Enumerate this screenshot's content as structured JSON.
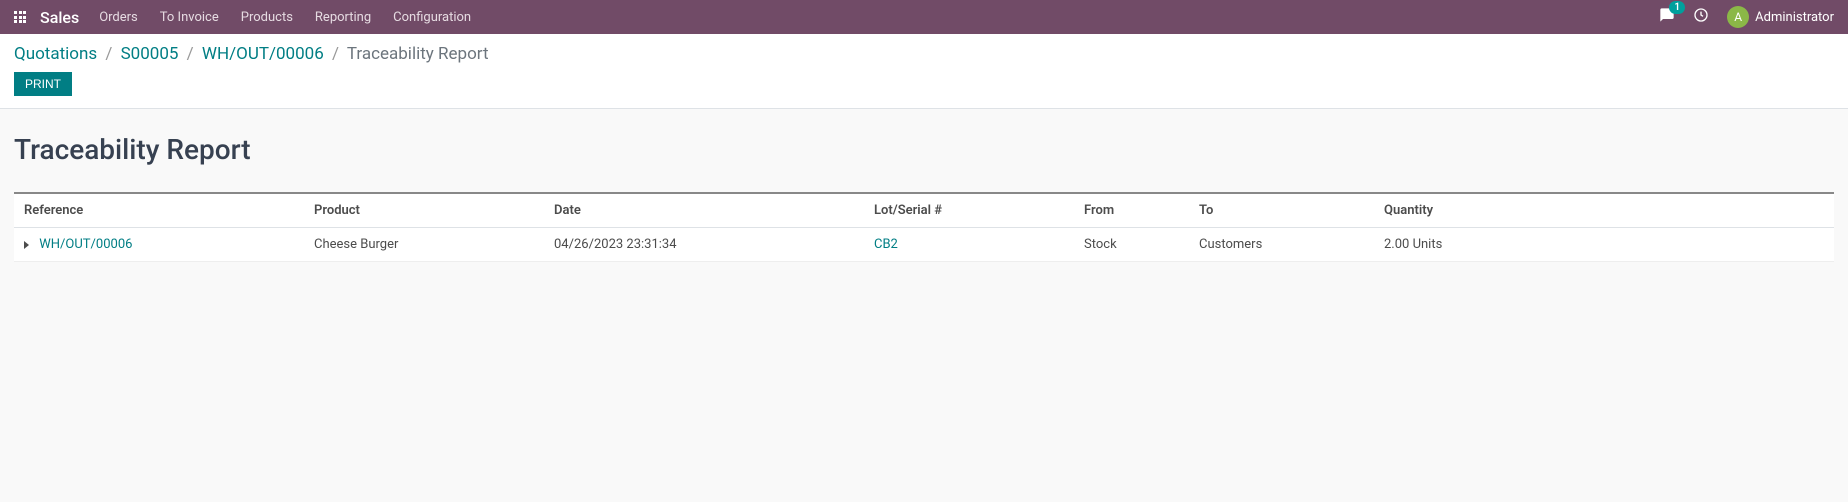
{
  "navbar": {
    "brand": "Sales",
    "menu": [
      "Orders",
      "To Invoice",
      "Products",
      "Reporting",
      "Configuration"
    ],
    "chat_badge": "1",
    "user_initial": "A",
    "username": "Administrator"
  },
  "breadcrumb": {
    "items": [
      "Quotations",
      "S00005",
      "WH/OUT/00006"
    ],
    "current": "Traceability Report"
  },
  "buttons": {
    "print": "PRINT"
  },
  "report": {
    "title": "Traceability Report",
    "columns": {
      "reference": "Reference",
      "product": "Product",
      "date": "Date",
      "lot": "Lot/Serial #",
      "from": "From",
      "to": "To",
      "quantity": "Quantity"
    },
    "rows": [
      {
        "reference": "WH/OUT/00006",
        "product": "Cheese Burger",
        "date": "04/26/2023 23:31:34",
        "lot": "CB2",
        "from": "Stock",
        "to": "Customers",
        "quantity": "2.00 Units"
      }
    ]
  }
}
